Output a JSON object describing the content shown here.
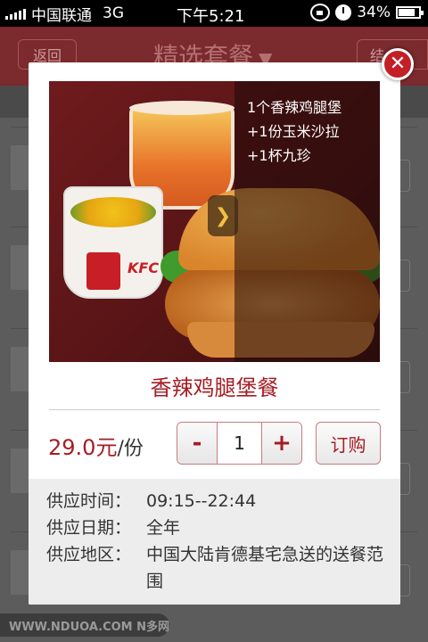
{
  "status_bar": {
    "carrier": "中国联通",
    "network": "3G",
    "time": "下午5:21",
    "battery": "34%"
  },
  "background": {
    "back_label": "返回",
    "title": "精选套餐",
    "right_label": "结"
  },
  "modal": {
    "image_caption_lines": [
      "1个香辣鸡腿堡",
      "+1份玉米沙拉",
      "+1杯九珍"
    ],
    "product_name": "香辣鸡腿堡餐",
    "price": "29.0元",
    "price_unit": "/份",
    "quantity": "1",
    "minus_label": "-",
    "plus_label": "+",
    "order_label": "订购",
    "info": [
      {
        "label": "供应时间：",
        "value": "09:15--22:44"
      },
      {
        "label": "供应日期：",
        "value": "全年"
      },
      {
        "label": "供应地区：",
        "value": "中国大陆肯德基宅急送的送餐范围"
      }
    ],
    "kfc_text": "KFC"
  },
  "watermark": "WWW.NDUOA.COM N多网",
  "colors": {
    "brand_red": "#a61c23",
    "close_red": "#c21f27"
  }
}
